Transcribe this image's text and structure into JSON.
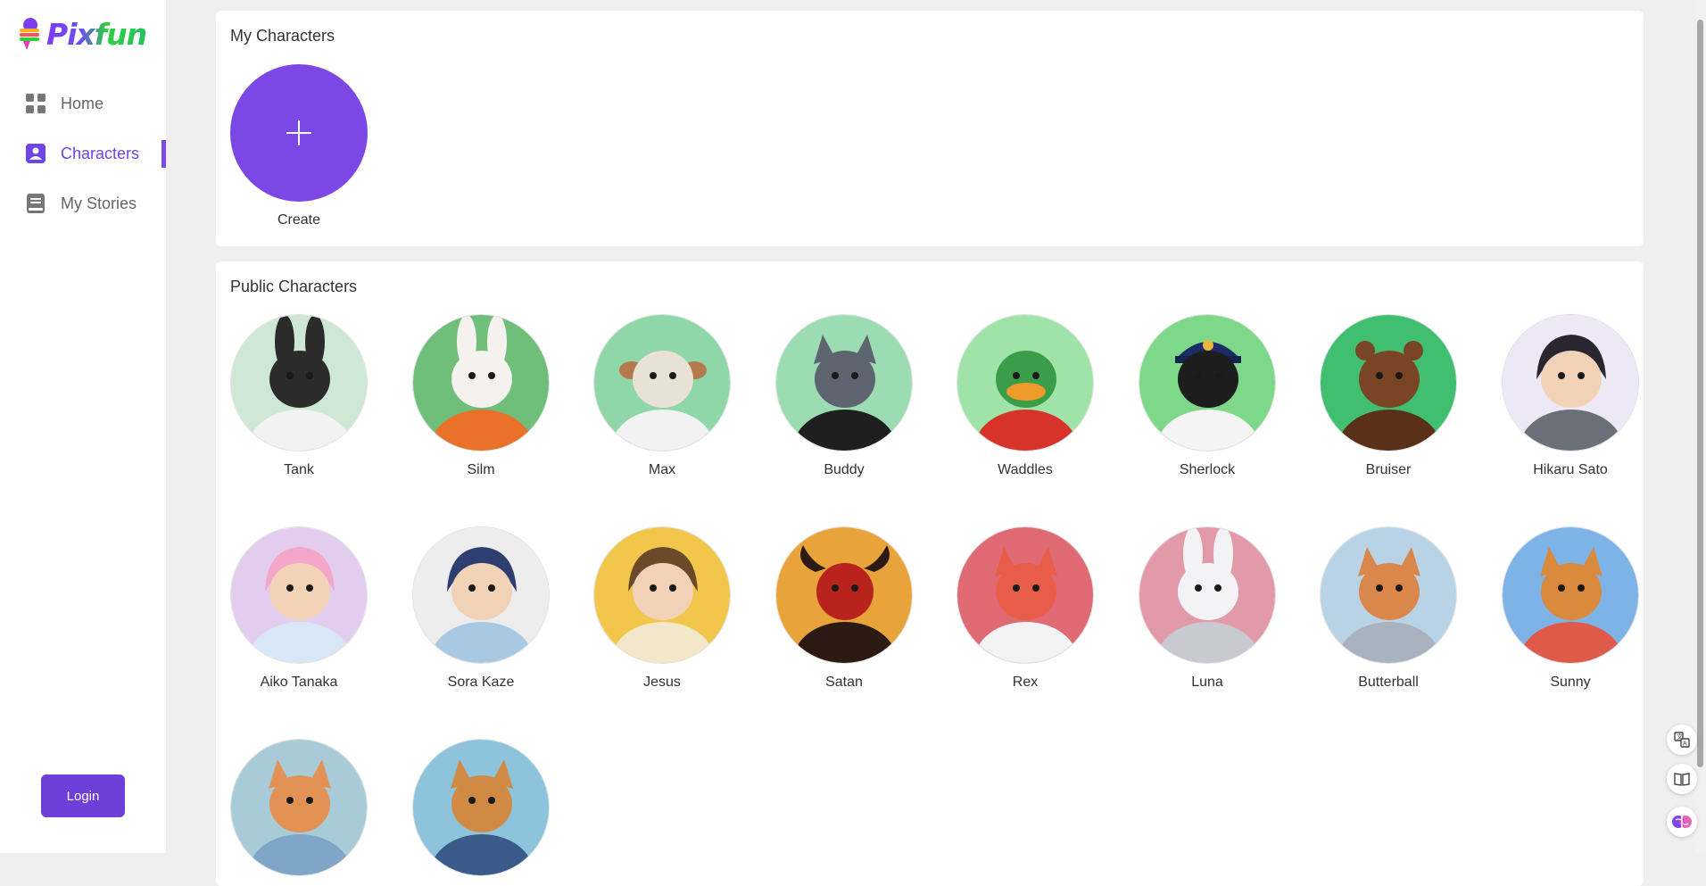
{
  "app": {
    "logo_text": "Pixfun",
    "accent_color": "#7b48e6"
  },
  "sidebar": {
    "items": [
      {
        "label": "Home",
        "icon": "grid-icon",
        "active": false
      },
      {
        "label": "Characters",
        "icon": "user-card-icon",
        "active": true
      },
      {
        "label": "My Stories",
        "icon": "book-icon",
        "active": false
      }
    ],
    "login_label": "Login"
  },
  "my_characters": {
    "title": "My Characters",
    "create_label": "Create"
  },
  "public_characters": {
    "title": "Public Characters",
    "items": [
      {
        "name": "Tank",
        "icon": "black-rabbit-avatar"
      },
      {
        "name": "Silm",
        "icon": "white-rabbit-avatar"
      },
      {
        "name": "Max",
        "icon": "bulldog-avatar"
      },
      {
        "name": "Buddy",
        "icon": "husky-avatar"
      },
      {
        "name": "Waddles",
        "icon": "duck-avatar"
      },
      {
        "name": "Sherlock",
        "icon": "police-dog-avatar"
      },
      {
        "name": "Bruiser",
        "icon": "bear-avatar"
      },
      {
        "name": "Hikaru Sato",
        "icon": "anime-boy-avatar"
      },
      {
        "name": "Aiko Tanaka",
        "icon": "anime-girl-pink-avatar"
      },
      {
        "name": "Sora Kaze",
        "icon": "anime-girl-blue-avatar"
      },
      {
        "name": "Jesus",
        "icon": "bearded-man-avatar"
      },
      {
        "name": "Satan",
        "icon": "devil-avatar"
      },
      {
        "name": "Rex",
        "icon": "fox-avatar"
      },
      {
        "name": "Luna",
        "icon": "fluffy-rabbit-avatar"
      },
      {
        "name": "Butterball",
        "icon": "fat-cat-avatar"
      },
      {
        "name": "Sunny",
        "icon": "muscle-cat-avatar"
      },
      {
        "name": "",
        "icon": "kitten-avatar"
      },
      {
        "name": "",
        "icon": "muscle-shiba-avatar"
      }
    ]
  },
  "floating_tools": [
    {
      "icon": "translate-icon"
    },
    {
      "icon": "reader-icon"
    },
    {
      "icon": "ai-brain-icon"
    }
  ]
}
